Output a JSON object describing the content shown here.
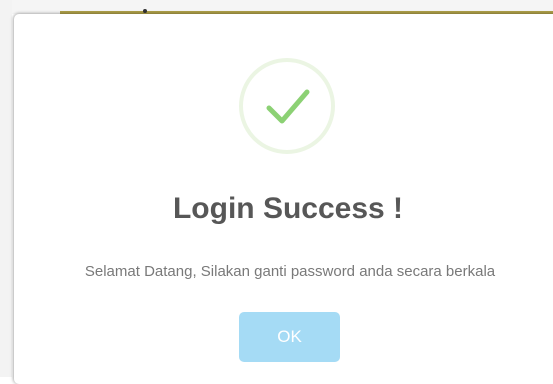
{
  "dialog": {
    "icon": "checkmark-success-icon",
    "title": "Login Success !",
    "message": "Selamat Datang, Silakan ganti password anda secara berkala",
    "confirm_label": "OK"
  },
  "colors": {
    "title": "#575757",
    "message": "#797979",
    "button_background": "#a5dbf5",
    "button_text": "#ffffff",
    "checkmark": "#8cd174",
    "icon_ring": "#ebf5e3"
  }
}
